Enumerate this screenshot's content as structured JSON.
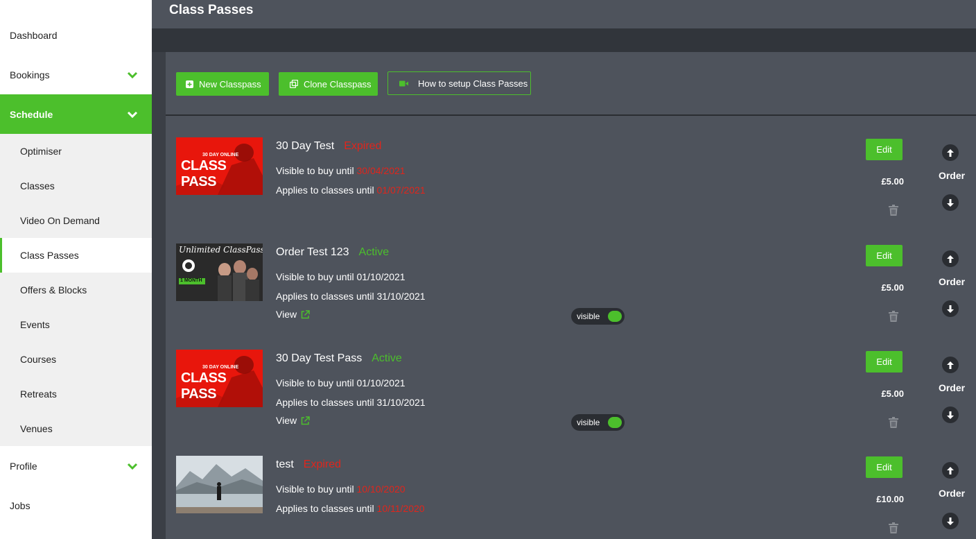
{
  "header": {
    "title": "Class Passes"
  },
  "sidebar": {
    "items": [
      {
        "label": "Dashboard"
      },
      {
        "label": "Bookings"
      },
      {
        "label": "Schedule"
      },
      {
        "label": "Optimiser"
      },
      {
        "label": "Classes"
      },
      {
        "label": "Video On Demand"
      },
      {
        "label": "Class Passes"
      },
      {
        "label": "Offers & Blocks"
      },
      {
        "label": "Events"
      },
      {
        "label": "Courses"
      },
      {
        "label": "Retreats"
      },
      {
        "label": "Venues"
      },
      {
        "label": "Profile"
      },
      {
        "label": "Jobs"
      }
    ]
  },
  "toolbar": {
    "new_label": "New Classpass",
    "clone_label": "Clone Classpass",
    "howto_label": "How to setup Class Passes"
  },
  "passes": [
    {
      "title": "30 Day Test",
      "status": "Expired",
      "visible_prefix": "Visible to buy until",
      "visible_date": "30/04/2021",
      "applies_prefix": "Applies to classes until",
      "applies_date": "01/07/2021",
      "price": "£5.00",
      "edit_label": "Edit",
      "order_label": "Order",
      "thumb_top": "30 DAY ONLINE",
      "thumb_main": "CLASS PASS"
    },
    {
      "title": "Order Test 123",
      "status": "Active",
      "visible_text": "Visible to buy until 01/10/2021",
      "applies_text": "Applies to classes until 31/10/2021",
      "view_label": "View",
      "toggle_label": "visible",
      "price": "£5.00",
      "edit_label": "Edit",
      "order_label": "Order",
      "thumb_script": "Unlimited ClassPass",
      "thumb_badge": "1 MONTH"
    },
    {
      "title": "30 Day Test Pass",
      "status": "Active",
      "visible_text": "Visible to buy until 01/10/2021",
      "applies_text": "Applies to classes until 31/10/2021",
      "view_label": "View",
      "toggle_label": "visible",
      "price": "£5.00",
      "edit_label": "Edit",
      "order_label": "Order",
      "thumb_top": "30 DAY ONLINE",
      "thumb_main": "CLASS PASS"
    },
    {
      "title": "test",
      "status": "Expired",
      "visible_prefix": "Visible to buy until",
      "visible_date": "10/10/2020",
      "applies_prefix": "Applies to classes until",
      "applies_date": "10/11/2020",
      "price": "£10.00",
      "edit_label": "Edit",
      "order_label": "Order"
    }
  ],
  "colors": {
    "accent": "#4cbf2c",
    "expired": "#e0251c",
    "panel": "#4e535c"
  }
}
